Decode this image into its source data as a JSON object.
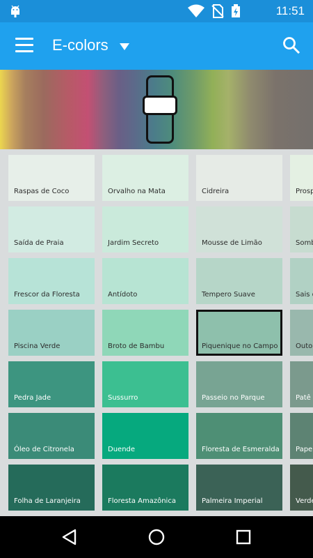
{
  "status_bar": {
    "time": "11:51",
    "icons": [
      "android-icon",
      "wifi-icon",
      "no-sim-icon",
      "battery-charging-icon"
    ]
  },
  "app_bar": {
    "title": "E-colors",
    "menu_icon": "hamburger-menu-icon",
    "dropdown_icon": "caret-down-icon",
    "search_icon": "search-icon"
  },
  "spectrum": {
    "slider_icon": "slider-handle-icon"
  },
  "colors": {
    "accent": "#1fa1ee",
    "status": "#1b8fd9"
  },
  "columns": [
    {
      "swatches": [
        {
          "name": "Raspas de Coco",
          "color": "#e7efe9"
        },
        {
          "name": "Saída de Praia",
          "color": "#d2ebe2"
        },
        {
          "name": "Frescor da Floresta",
          "color": "#b7e3d7"
        },
        {
          "name": "Piscina Verde",
          "color": "#9ad0c4"
        },
        {
          "name": "Pedra Jade",
          "color": "#3d9580"
        },
        {
          "name": "Óleo de Citronela",
          "color": "#3b8b78"
        },
        {
          "name": "Folha de Laranjeira",
          "color": "#256b5a"
        }
      ]
    },
    {
      "swatches": [
        {
          "name": "Orvalho na Mata",
          "color": "#dcefe3"
        },
        {
          "name": "Jardim Secreto",
          "color": "#caeadb"
        },
        {
          "name": "Antídoto",
          "color": "#b7e4d3"
        },
        {
          "name": "Broto de Bambu",
          "color": "#8fd7b8"
        },
        {
          "name": "Sussurro",
          "color": "#3cbf91"
        },
        {
          "name": "Duende",
          "color": "#06a97e"
        },
        {
          "name": "Floresta Amazônica",
          "color": "#1b7a5e"
        }
      ]
    },
    {
      "swatches": [
        {
          "name": "Cidreira",
          "color": "#e6ebe6"
        },
        {
          "name": "Mousse de Limão",
          "color": "#d0e1d8"
        },
        {
          "name": "Tempero Suave",
          "color": "#b6d6c8"
        },
        {
          "name": "Piquenique no Campo",
          "color": "#8ec0ac",
          "selected": true
        },
        {
          "name": "Passeio no Parque",
          "color": "#78a493"
        },
        {
          "name": "Floresta de Esmeralda",
          "color": "#4e8f75"
        },
        {
          "name": "Palmeira Imperial",
          "color": "#3b6256"
        }
      ]
    },
    {
      "swatches": [
        {
          "name": "Prosp",
          "color": "#e4f0e3"
        },
        {
          "name": "Somb",
          "color": "#c7dcd0"
        },
        {
          "name": "Sais d",
          "color": "#b1d1c4"
        },
        {
          "name": "Outon",
          "color": "#99b8ad"
        },
        {
          "name": "Patê d",
          "color": "#7b9a8d"
        },
        {
          "name": "Papel",
          "color": "#5d8373"
        },
        {
          "name": "Verde",
          "color": "#445a4c"
        }
      ]
    }
  ],
  "nav_bar": {
    "back_icon": "back-triangle-icon",
    "home_icon": "home-circle-icon",
    "recents_icon": "recents-square-icon"
  }
}
